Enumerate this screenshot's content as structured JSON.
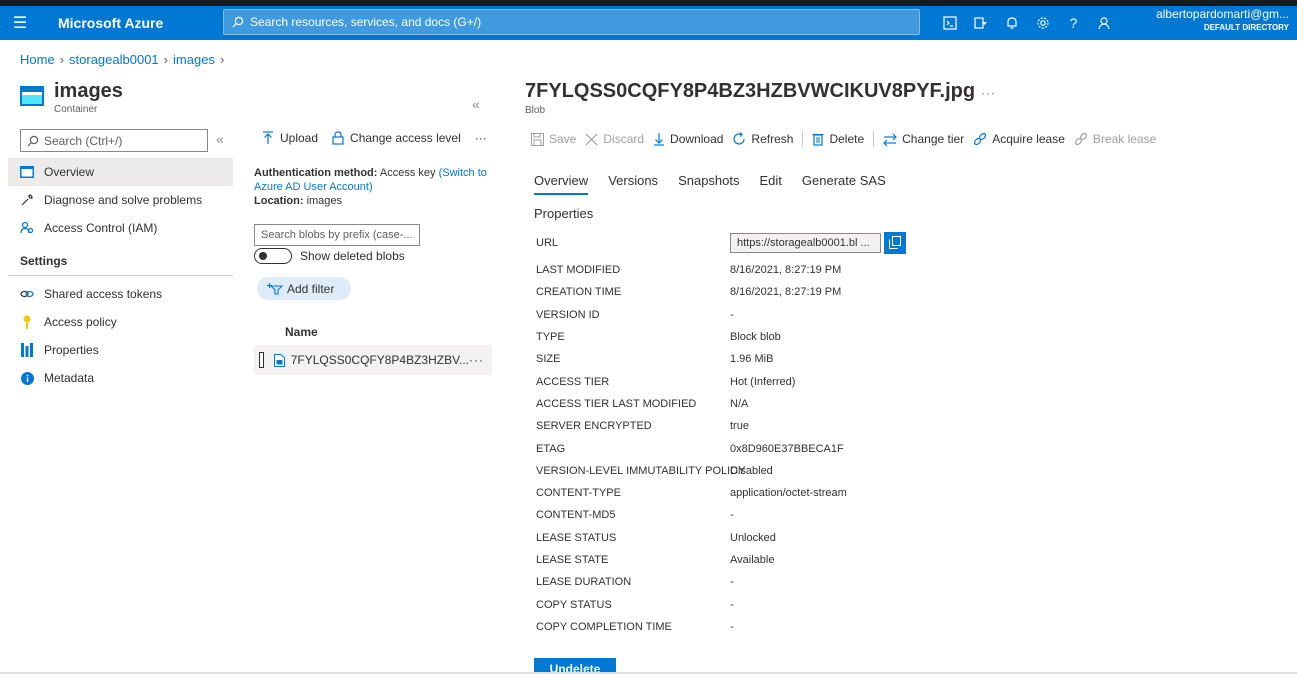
{
  "topbar": {
    "brand": "Microsoft Azure",
    "search_placeholder": "Search resources, services, and docs (G+/)",
    "user_name": "albertopardomarti@gm...",
    "user_directory": "DEFAULT DIRECTORY"
  },
  "breadcrumb": [
    "Home",
    "storagealb0001",
    "images"
  ],
  "resource": {
    "title": "images",
    "subtitle": "Container"
  },
  "nav": {
    "search_placeholder": "Search (Ctrl+/)",
    "items": [
      {
        "label": "Overview"
      },
      {
        "label": "Diagnose and solve problems"
      },
      {
        "label": "Access Control (IAM)"
      }
    ],
    "settings_label": "Settings",
    "settings_items": [
      {
        "label": "Shared access tokens"
      },
      {
        "label": "Access policy"
      },
      {
        "label": "Properties"
      },
      {
        "label": "Metadata"
      }
    ]
  },
  "container": {
    "upload_label": "Upload",
    "change_access_label": "Change access level",
    "auth_method_label": "Authentication method:",
    "auth_method_value": "Access key",
    "auth_switch_link": "(Switch to Azure AD User Account)",
    "location_label": "Location:",
    "location_value": "images",
    "blob_search_placeholder": "Search blobs by prefix (case-...",
    "show_deleted_label": "Show deleted blobs",
    "add_filter_label": "Add filter",
    "name_column": "Name",
    "blobs": [
      {
        "name": "7FYLQSS0CQFY8P4BZ3HZBV..."
      }
    ]
  },
  "blob": {
    "title": "7FYLQSS0CQFY8P4BZ3HZBVWCIKUV8PYF.jpg",
    "subtitle": "Blob",
    "toolbar": {
      "save": "Save",
      "discard": "Discard",
      "download": "Download",
      "refresh": "Refresh",
      "delete": "Delete",
      "change_tier": "Change tier",
      "acquire_lease": "Acquire lease",
      "break_lease": "Break lease"
    },
    "tabs": [
      "Overview",
      "Versions",
      "Snapshots",
      "Edit",
      "Generate SAS"
    ],
    "properties_heading": "Properties",
    "url_label": "URL",
    "url_value": "https://storagealb0001.bl ...",
    "properties": [
      {
        "key": "LAST MODIFIED",
        "value": "8/16/2021, 8:27:19 PM"
      },
      {
        "key": "CREATION TIME",
        "value": "8/16/2021, 8:27:19 PM"
      },
      {
        "key": "VERSION ID",
        "value": "-"
      },
      {
        "key": "TYPE",
        "value": "Block blob"
      },
      {
        "key": "SIZE",
        "value": "1.96 MiB"
      },
      {
        "key": "ACCESS TIER",
        "value": "Hot (Inferred)"
      },
      {
        "key": "ACCESS TIER LAST MODIFIED",
        "value": "N/A"
      },
      {
        "key": "SERVER ENCRYPTED",
        "value": "true"
      },
      {
        "key": "ETAG",
        "value": "0x8D960E37BBECA1F"
      },
      {
        "key": "VERSION-LEVEL IMMUTABILITY POLICY",
        "value": "Disabled"
      },
      {
        "key": "CONTENT-TYPE",
        "value": "application/octet-stream"
      },
      {
        "key": "CONTENT-MD5",
        "value": "-"
      },
      {
        "key": "LEASE STATUS",
        "value": "Unlocked"
      },
      {
        "key": "LEASE STATE",
        "value": "Available"
      },
      {
        "key": "LEASE DURATION",
        "value": "-"
      },
      {
        "key": "COPY STATUS",
        "value": "-"
      },
      {
        "key": "COPY COMPLETION TIME",
        "value": "-"
      }
    ],
    "undelete_label": "Undelete"
  }
}
